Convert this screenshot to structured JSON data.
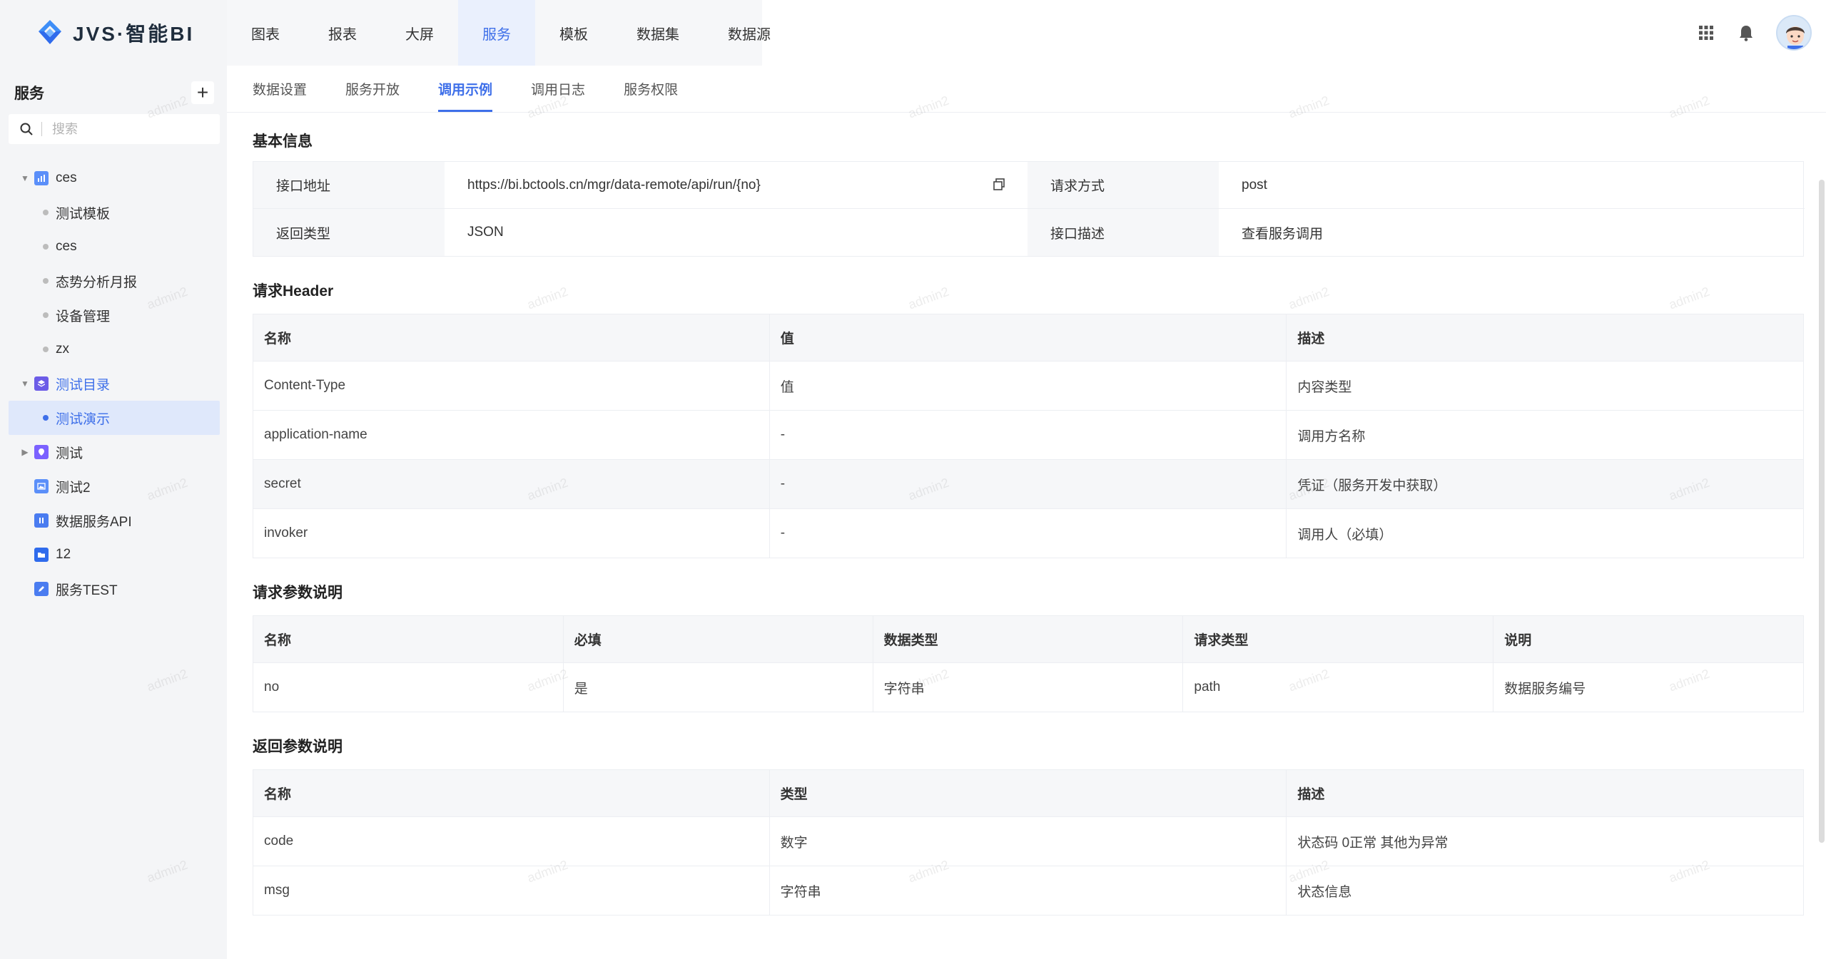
{
  "app": {
    "logo_text": "JVS·智能BI",
    "nav": [
      "图表",
      "报表",
      "大屏",
      "服务",
      "模板",
      "数据集",
      "数据源"
    ],
    "nav_active_index": 3
  },
  "sidebar": {
    "title": "服务",
    "add_label": "+",
    "search_placeholder": "搜索",
    "tree": [
      {
        "label": "ces",
        "type": "folder",
        "expanded": true,
        "icon_color": "#5b8ff9"
      },
      {
        "label": "测试模板",
        "type": "leaf"
      },
      {
        "label": "ces",
        "type": "leaf"
      },
      {
        "label": "态势分析月报",
        "type": "leaf"
      },
      {
        "label": "设备管理",
        "type": "leaf"
      },
      {
        "label": "zx",
        "type": "leaf"
      },
      {
        "label": "测试目录",
        "type": "folder",
        "expanded": true,
        "icon_color": "#6c5ce7"
      },
      {
        "label": "测试演示",
        "type": "leaf",
        "selected": true
      },
      {
        "label": "测试",
        "type": "folder",
        "expanded": false,
        "icon_color": "#7b61ff"
      },
      {
        "label": "测试2",
        "type": "folder",
        "icon_color": "#5b8ff9"
      },
      {
        "label": "数据服务API",
        "type": "folder",
        "icon_color": "#4a7cf0"
      },
      {
        "label": "12",
        "type": "folder",
        "icon_color": "#2f6bec"
      },
      {
        "label": "服务TEST",
        "type": "folder",
        "icon_color": "#4a7cf0"
      }
    ]
  },
  "tabs": [
    "数据设置",
    "服务开放",
    "调用示例",
    "调用日志",
    "服务权限"
  ],
  "tab_active_index": 2,
  "basic": {
    "title": "基本信息",
    "url_label": "接口地址",
    "url_value": "https://bi.bctools.cn/mgr/data-remote/api/run/{no}",
    "method_label": "请求方式",
    "method_value": "post",
    "return_label": "返回类型",
    "return_value": "JSON",
    "desc_label": "接口描述",
    "desc_value": "查看服务调用"
  },
  "header_section": {
    "title": "请求Header",
    "columns": [
      "名称",
      "值",
      "描述"
    ],
    "rows": [
      [
        "Content-Type",
        "值",
        "内容类型"
      ],
      [
        "application-name",
        "-",
        "调用方名称"
      ],
      [
        "secret",
        "-",
        "凭证（服务开发中获取）"
      ],
      [
        "invoker",
        "-",
        "调用人（必填）"
      ]
    ]
  },
  "params_section": {
    "title": "请求参数说明",
    "columns": [
      "名称",
      "必填",
      "数据类型",
      "请求类型",
      "说明"
    ],
    "rows": [
      [
        "no",
        "是",
        "字符串",
        "path",
        "数据服务编号"
      ]
    ]
  },
  "return_section": {
    "title": "返回参数说明",
    "columns": [
      "名称",
      "类型",
      "描述"
    ],
    "rows": [
      [
        "code",
        "数字",
        "状态码 0正常 其他为异常"
      ],
      [
        "msg",
        "字符串",
        "状态信息"
      ]
    ]
  },
  "watermark_text": "admin2",
  "colors": {
    "accent": "#3e6fe9",
    "sidebar_bg": "#f4f5f7",
    "table_header_bg": "#f6f7f9"
  }
}
